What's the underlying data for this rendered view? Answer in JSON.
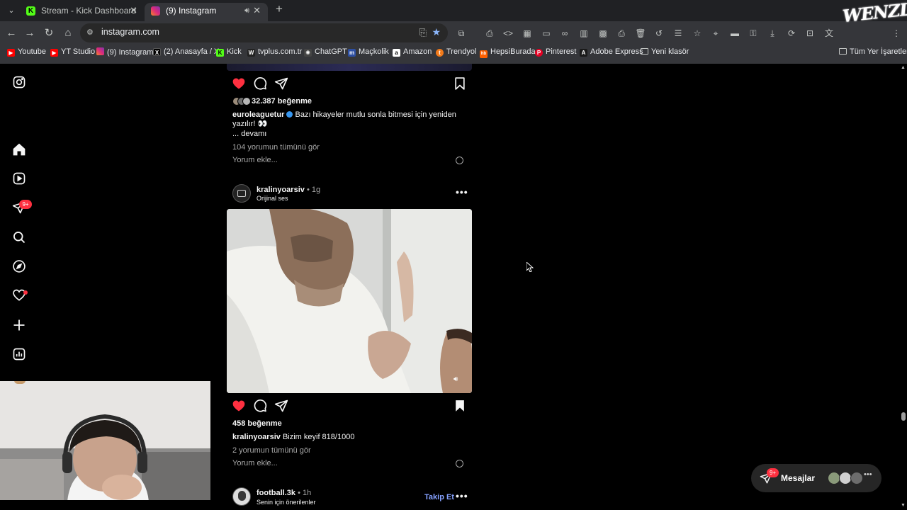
{
  "browser": {
    "tabs": [
      {
        "title": "Stream - Kick Dashboard",
        "favicon_color": "#53fc18"
      },
      {
        "title": "(9) Instagram",
        "favicon_color": "#e1306c"
      }
    ],
    "url": "instagram.com",
    "profile_label": "WENZLL",
    "bookmarks": [
      {
        "label": "Youtube",
        "color": "#ff0000",
        "glyph": "▶"
      },
      {
        "label": "YT Studio",
        "color": "#ff0000",
        "glyph": "▶"
      },
      {
        "label": "(9) Instagram",
        "color": "#e1306c",
        "glyph": "◎"
      },
      {
        "label": "(2) Anasayfa / X",
        "color": "#000000",
        "glyph": "X"
      },
      {
        "label": "Kick",
        "color": "#53fc18",
        "glyph": "K"
      },
      {
        "label": "tvplus.com.tr",
        "color": "#222222",
        "glyph": "W"
      },
      {
        "label": "ChatGPT",
        "color": "#444444",
        "glyph": "✺"
      },
      {
        "label": "Maçkolik",
        "color": "#2d4fa3",
        "glyph": "m"
      },
      {
        "label": "Amazon",
        "color": "#ffffff",
        "glyph": "a"
      },
      {
        "label": "Trendyol",
        "color": "#f27a1a",
        "glyph": "t"
      },
      {
        "label": "HepsiBurada",
        "color": "#ff6000",
        "glyph": "hb"
      },
      {
        "label": "Pinterest",
        "color": "#e60023",
        "glyph": "P"
      },
      {
        "label": "Adobe Express",
        "color": "#1a1a1a",
        "glyph": "A"
      },
      {
        "label": "Yeni klasör",
        "color": "transparent",
        "glyph": "▭"
      }
    ],
    "all_bookmarks": "Tüm Yer İşaretleri"
  },
  "sidebar": {
    "notifications_badge": "9+"
  },
  "post1": {
    "likes": "32.387 beğenme",
    "username": "euroleaguetur",
    "caption": "Bazı hikayeler mutlu sonla bitmesi için yeniden yazılır! 👀",
    "more": "... devamı",
    "view_comments": "104 yorumun tümünü gör",
    "add_comment": "Yorum ekle..."
  },
  "post2": {
    "username": "kralinyoarsiv",
    "time": "1g",
    "audio": "Orijinal ses",
    "likes": "458 beğenme",
    "caption_user": "kralinyoarsiv",
    "caption": "Bizim keyif 818/1000",
    "view_comments": "2 yorumun tümünü gör",
    "add_comment": "Yorum ekle..."
  },
  "post3": {
    "username": "football.3k",
    "time": "1h",
    "sub": "Senin için önerilenler",
    "follow": "Takip Et"
  },
  "messages": {
    "label": "Mesajlar",
    "badge": "9+"
  }
}
